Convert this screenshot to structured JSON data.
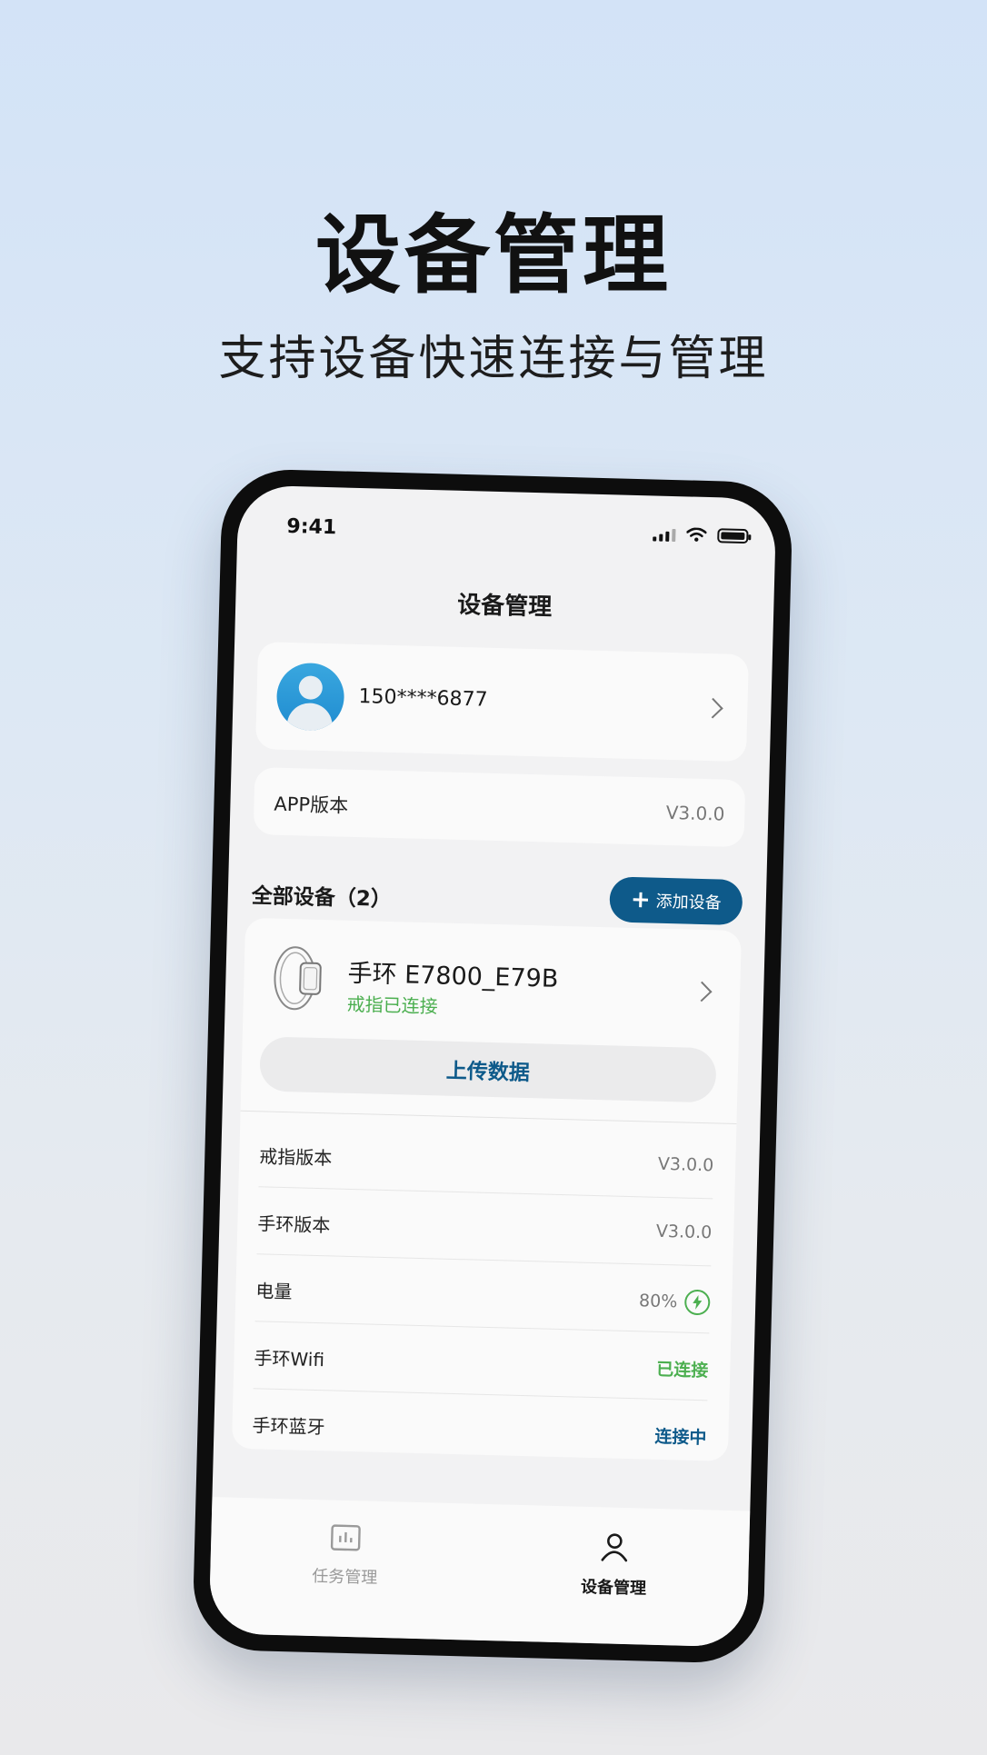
{
  "hero": {
    "title": "设备管理",
    "subtitle": "支持设备快速连接与管理"
  },
  "status_bar": {
    "time": "9:41"
  },
  "nav": {
    "title": "设备管理"
  },
  "profile": {
    "phone": "150****6877"
  },
  "app_version": {
    "label": "APP版本",
    "value": "V3.0.0"
  },
  "devices_section": {
    "title": "全部设备（2）",
    "add_label": "添加设备"
  },
  "device": {
    "name": "手环 E7800_E79B",
    "status": "戒指已连接",
    "upload_label": "上传数据",
    "details": [
      {
        "label": "戒指版本",
        "value": "V3.0.0"
      },
      {
        "label": "手环版本",
        "value": "V3.0.0"
      },
      {
        "label": "电量",
        "value": "80%"
      },
      {
        "label": "手环Wifi",
        "value": "已连接"
      },
      {
        "label": "手环蓝牙",
        "value": "连接中"
      }
    ]
  },
  "tabbar": {
    "tasks": "任务管理",
    "devices": "设备管理"
  },
  "colors": {
    "accent": "#0e5a8a",
    "success": "#4caf50"
  }
}
